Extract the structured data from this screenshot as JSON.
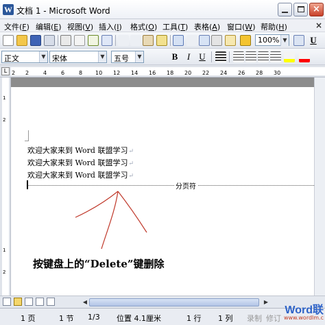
{
  "window": {
    "title": "文档 1 - Microsoft Word",
    "app_icon": "W",
    "close_glyph": "×"
  },
  "menu": {
    "items": [
      {
        "label": "文件(",
        "key": "F",
        "end": ")"
      },
      {
        "label": "编辑(",
        "key": "E",
        "end": ")"
      },
      {
        "label": "视图(",
        "key": "V",
        "end": ")"
      },
      {
        "label": "插入(",
        "key": "I",
        "end": ")"
      },
      {
        "label": "格式(",
        "key": "O",
        "end": ")"
      },
      {
        "label": "工具(",
        "key": "T",
        "end": ")"
      },
      {
        "label": "表格(",
        "key": "A",
        "end": ")"
      },
      {
        "label": "窗口(",
        "key": "W",
        "end": ")"
      },
      {
        "label": "帮助(",
        "key": "H",
        "end": ")"
      }
    ],
    "close_glyph": "×"
  },
  "toolbar": {
    "zoom": "100%",
    "style": "正文",
    "font": "宋体",
    "size": "五号",
    "bold": "B",
    "italic": "I",
    "underline": "U",
    "underline2": "U"
  },
  "ruler": {
    "numbers": [
      "2",
      "2",
      "4",
      "6",
      "8",
      "10",
      "12",
      "14",
      "16",
      "18",
      "20",
      "22",
      "24",
      "26",
      "28",
      "30"
    ],
    "vertical_numbers": [
      "1",
      "2",
      "1",
      "2"
    ]
  },
  "document": {
    "lines": [
      "欢迎大家来到 Word 联盟学习",
      "欢迎大家来到 Word 联盟学习",
      "欢迎大家来到 Word 联盟学习"
    ],
    "paragraph_mark": "↵",
    "page_break_label": "分页符",
    "annotation": "按键盘上的“Delete”键删除"
  },
  "status": {
    "page": "1 页",
    "section": "1 节",
    "pages": "1/3",
    "position": "位置 4.1厘米",
    "line": "1 行",
    "column": "1 列",
    "rec": "录制",
    "trk": "修订"
  },
  "watermark": {
    "word": "Word联",
    "url": "www.wordlm.c"
  },
  "colors": {
    "brand_blue": "#2b579a",
    "highlight": "#ffff00",
    "font_color": "#ff0000"
  }
}
